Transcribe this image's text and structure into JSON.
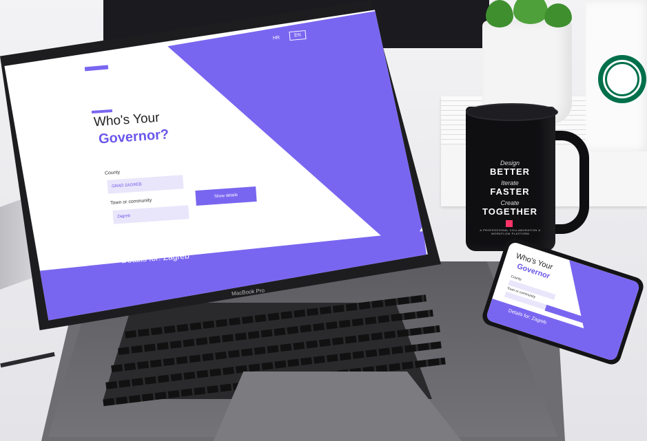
{
  "screen": {
    "lang_hr": "HR",
    "lang_en": "EN",
    "title_line1": "Who's Your",
    "title_line2": "Governor?",
    "county_label": "County",
    "county_value": "GRAD ZAGREB",
    "town_label": "Town or community",
    "town_value": "Zagreb",
    "show_button": "Show details",
    "details_banner": "Details for: Zagreb"
  },
  "laptop": {
    "brand_label": "MacBook Pro"
  },
  "mug": {
    "line1_small": "Design",
    "line1_big": "BETTER",
    "line2_small": "Iterate",
    "line2_big": "FASTER",
    "line3_small": "Create",
    "line3_big": "TOGETHER",
    "tagline": "A PROFESSIONAL COLLABORATION & WORKFLOW PLATFORM",
    "badge_color": "#ff3366"
  },
  "phone": {
    "title_line1": "Who's Your",
    "title_line2": "Governor",
    "county_label": "County",
    "town_label": "Town or community",
    "details_banner": "Details for: Zagreb"
  },
  "colors": {
    "accent": "#7966f0",
    "mug": "#0f0f12",
    "starbucks": "#00704a"
  }
}
